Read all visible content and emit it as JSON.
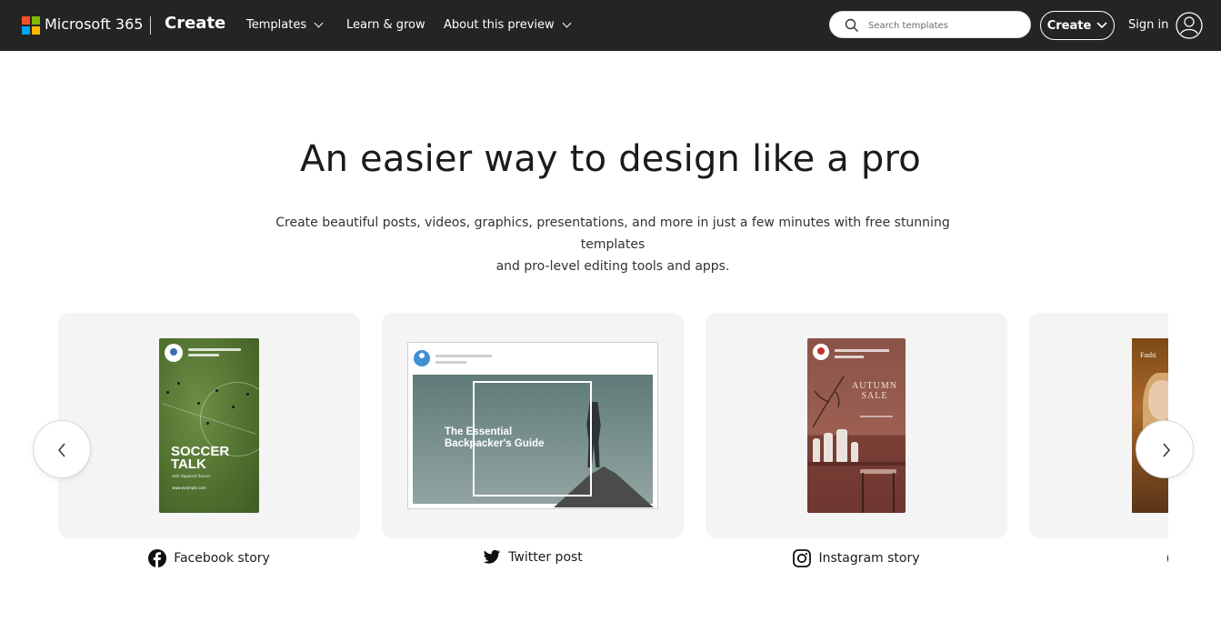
{
  "nav": {
    "brand": "Microsoft 365",
    "section": "Create",
    "links": [
      {
        "label": "Templates",
        "has_dropdown": true
      },
      {
        "label": "Learn & grow",
        "has_dropdown": false
      },
      {
        "label": "About this preview",
        "has_dropdown": true
      }
    ],
    "search_placeholder": "Search templates",
    "create_label": "Create",
    "sign_in_label": "Sign in",
    "logo_colors": [
      "#f25022",
      "#7fba00",
      "#00a4ef",
      "#ffb900"
    ]
  },
  "hero": {
    "title": "An easier way to design like a pro",
    "subtitle_line1": "Create beautiful posts, videos, graphics, presentations, and more in just a few minutes with free stunning templates",
    "subtitle_line2": "and pro-level editing tools and apps."
  },
  "carousel": {
    "cards": [
      {
        "label": "Facebook story",
        "icon": "facebook-icon",
        "thumb": {
          "title": "SOCCER TALK",
          "subtitle": "with Happiest Soccer",
          "footer": "www.example.com"
        }
      },
      {
        "label": "Twitter post",
        "icon": "twitter-icon",
        "thumb": {
          "title_line1": "The Essential",
          "title_line2": "Backpacker's Guide"
        }
      },
      {
        "label": "Instagram story",
        "icon": "instagram-icon",
        "thumb": {
          "title_line1": "AUTUMN",
          "title_line2": "SALE"
        }
      },
      {
        "label": "",
        "icon": "play-icon",
        "thumb": {
          "title": "Fashi"
        }
      }
    ],
    "prev_icon": "chevron-left-icon",
    "next_icon": "chevron-right-icon"
  }
}
